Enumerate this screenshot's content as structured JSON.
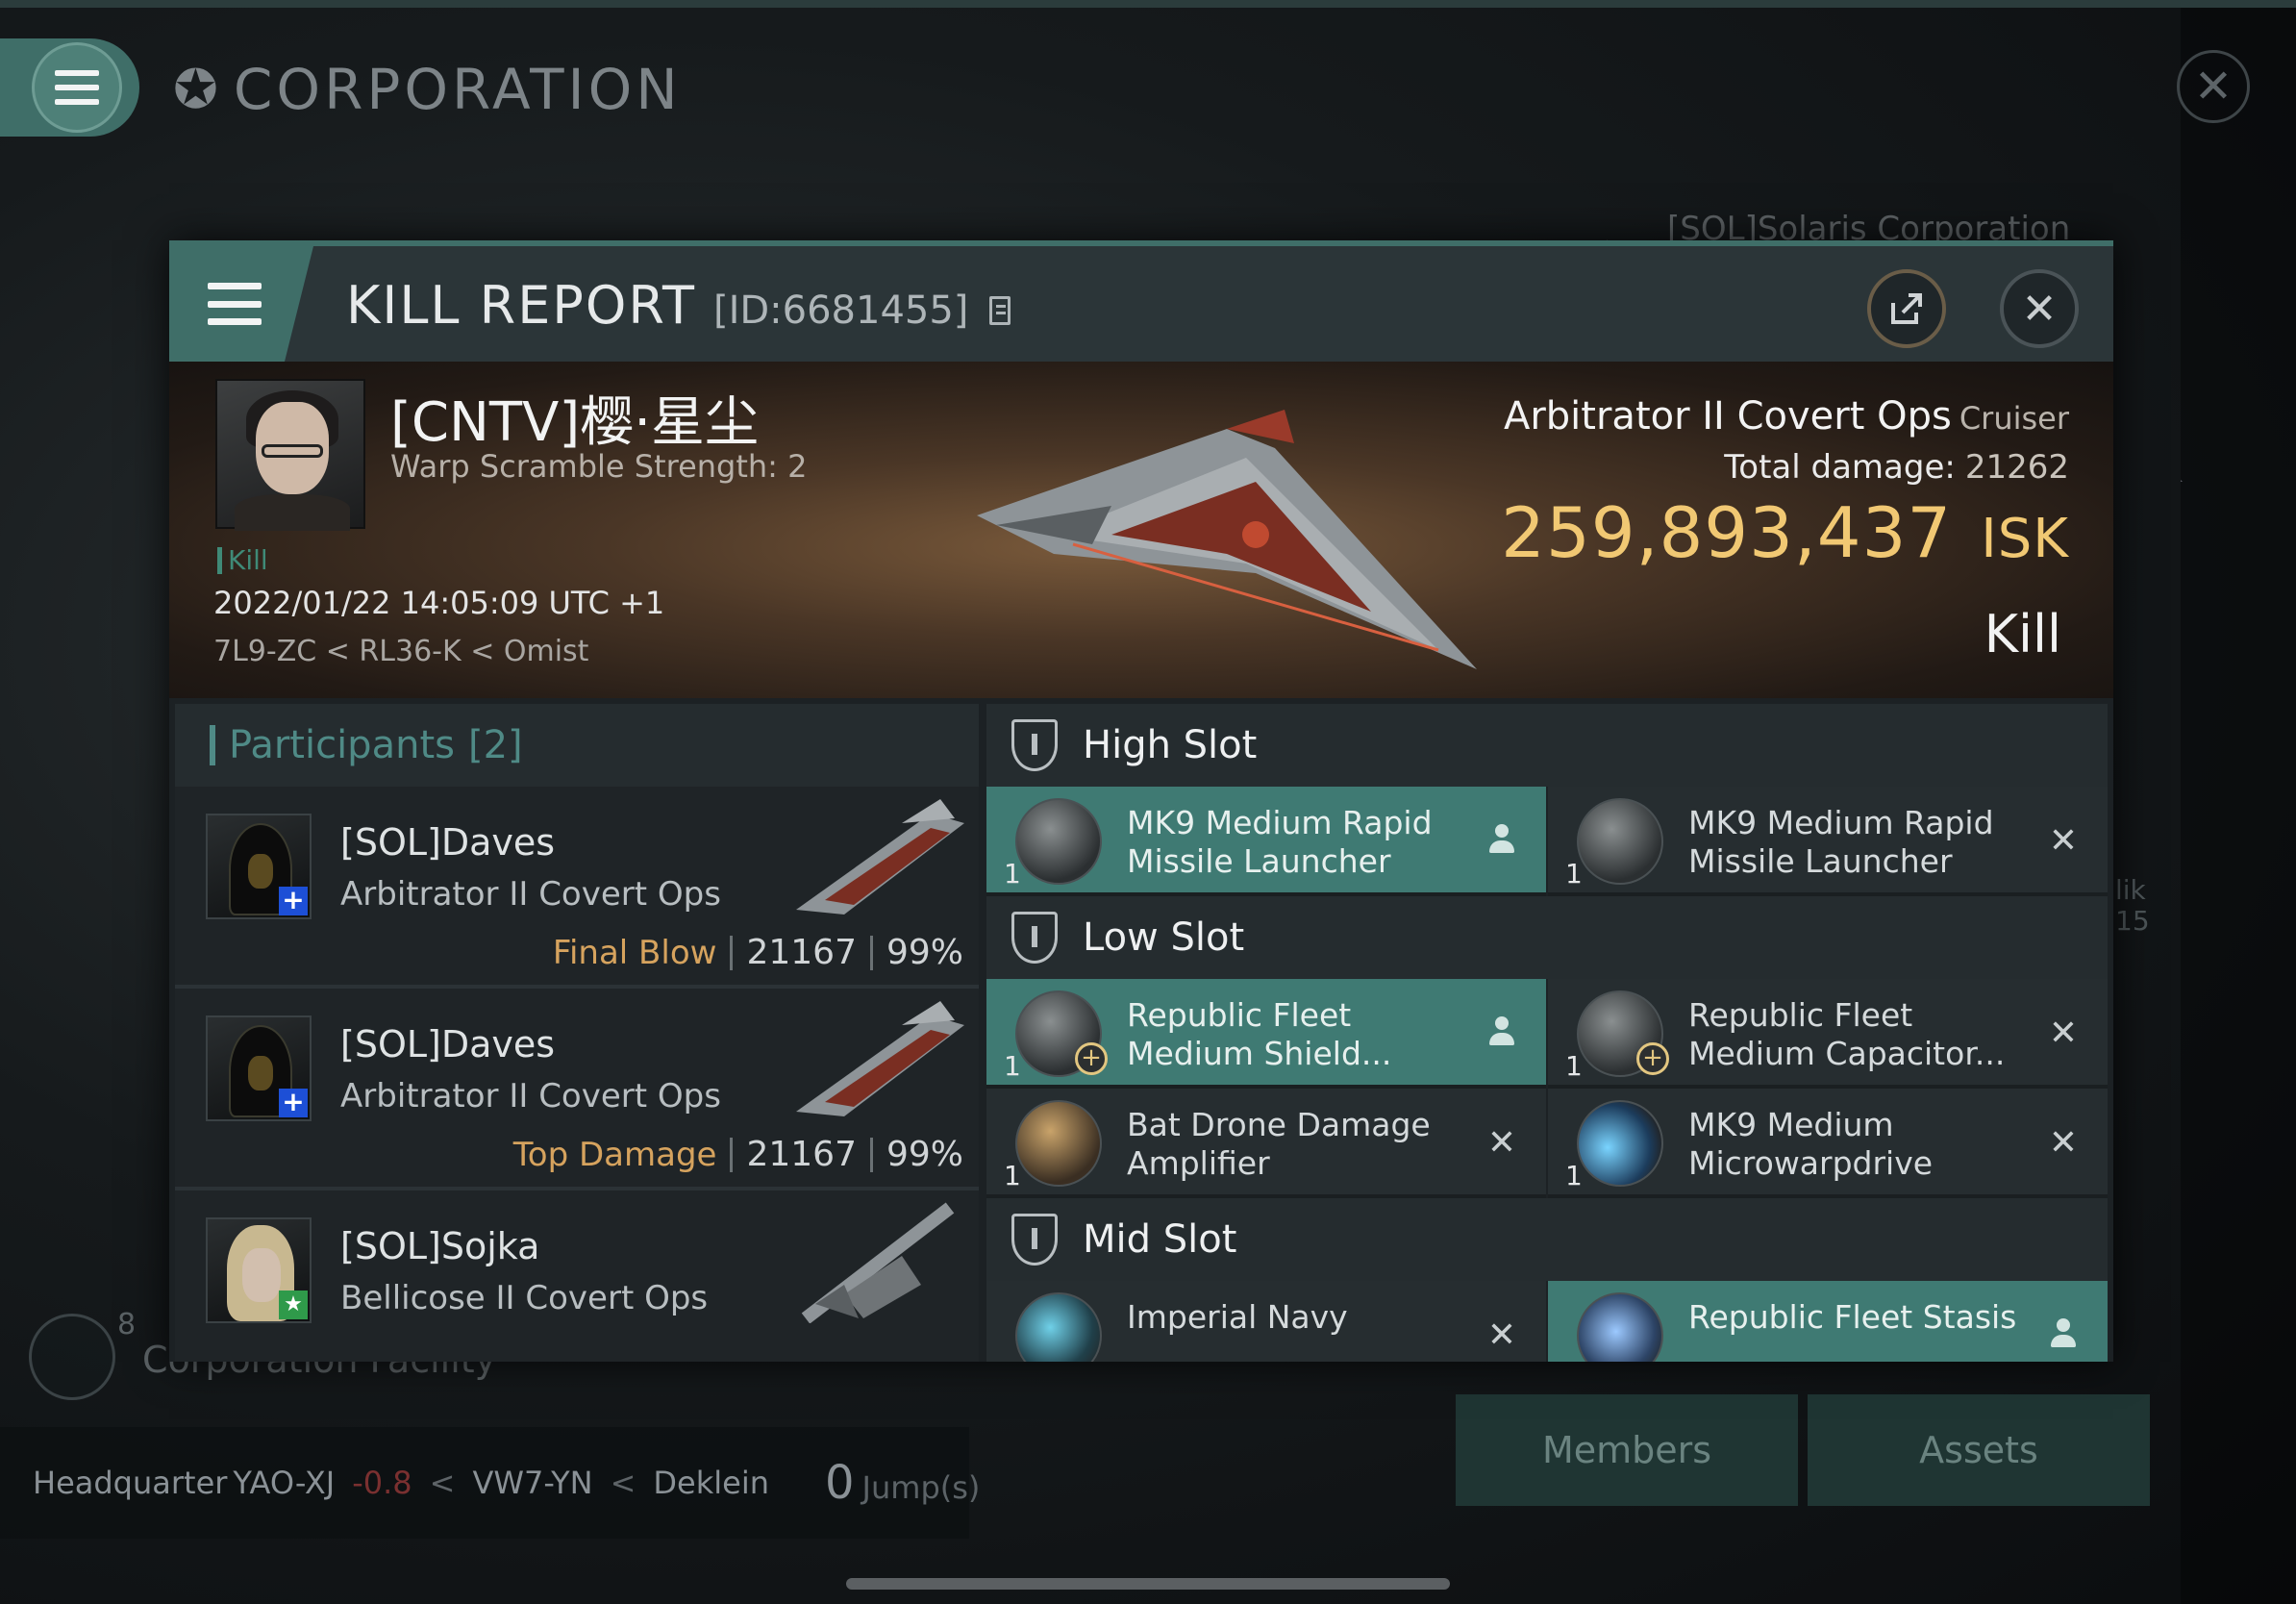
{
  "app": {
    "title": "CORPORATION",
    "corp_name_bg": "[SOL]Solaris Corporation",
    "facility_label": "Corporation Facility",
    "facility_count": "8",
    "side_text": [
      "lik",
      "15"
    ],
    "hq": {
      "label": "Headquarter",
      "system": "YAO-XJ",
      "security": "-0.8",
      "route": [
        "VW7-YN",
        "Deklein"
      ],
      "jumps_value": "0",
      "jumps_label": "Jump(s)"
    },
    "buttons": {
      "members": "Members",
      "assets": "Assets"
    }
  },
  "kill_report": {
    "title": "KILL REPORT",
    "id_label": "[ID:6681455]",
    "victim": {
      "name": "[CNTV]樱·星尘",
      "detail": "Warp Scramble Strength: 2",
      "kill_tag": "Kill",
      "datetime": "2022/01/22 14:05:09 UTC +1",
      "location": "7L9-ZC < RL36-K < Omist"
    },
    "ship": {
      "name": "Arbitrator II Covert Ops",
      "class": "Cruiser",
      "total_damage_label": "Total damage:",
      "total_damage": "21262",
      "isk_value": "259,893,437",
      "isk_unit": "ISK",
      "result": "Kill"
    },
    "participants": {
      "label": "Participants",
      "count": "[2]",
      "rows": [
        {
          "name": "[SOL]Daves",
          "ship": "Arbitrator II Covert Ops",
          "role": "Final Blow",
          "damage": "21167",
          "percent": "99%",
          "badge": "+"
        },
        {
          "name": "[SOL]Daves",
          "ship": "Arbitrator II Covert Ops",
          "role": "Top Damage",
          "damage": "21167",
          "percent": "99%",
          "badge": "+"
        },
        {
          "name": "[SOL]Sojka",
          "ship": "Bellicose II Covert Ops",
          "role": "",
          "damage": "",
          "percent": "",
          "badge": "★"
        }
      ]
    },
    "slots": {
      "high": {
        "label": "High Slot",
        "modules": [
          {
            "qty": "1",
            "name": "MK9 Medium Rapid Missile Launcher",
            "status": "dropped"
          },
          {
            "qty": "1",
            "name": "MK9 Medium Rapid Missile Launcher",
            "status": "destroyed"
          }
        ]
      },
      "low": {
        "label": "Low Slot",
        "modules": [
          {
            "qty": "1",
            "name": "Republic Fleet Medium Shield...",
            "status": "dropped"
          },
          {
            "qty": "1",
            "name": "Republic Fleet Medium Capacitor...",
            "status": "destroyed"
          },
          {
            "qty": "1",
            "name": "Bat Drone Damage Amplifier",
            "status": "destroyed"
          },
          {
            "qty": "1",
            "name": "MK9 Medium Microwarpdrive",
            "status": "destroyed"
          }
        ]
      },
      "mid": {
        "label": "Mid Slot",
        "modules": [
          {
            "qty": "",
            "name": "Imperial Navy",
            "status": "destroyed"
          },
          {
            "qty": "",
            "name": "Republic Fleet Stasis",
            "status": "dropped"
          }
        ]
      }
    }
  },
  "colors": {
    "accent": "#3f6e68",
    "isk": "#f1c873",
    "role": "#d6a35e",
    "dropped_bg": "#3f7a73"
  }
}
